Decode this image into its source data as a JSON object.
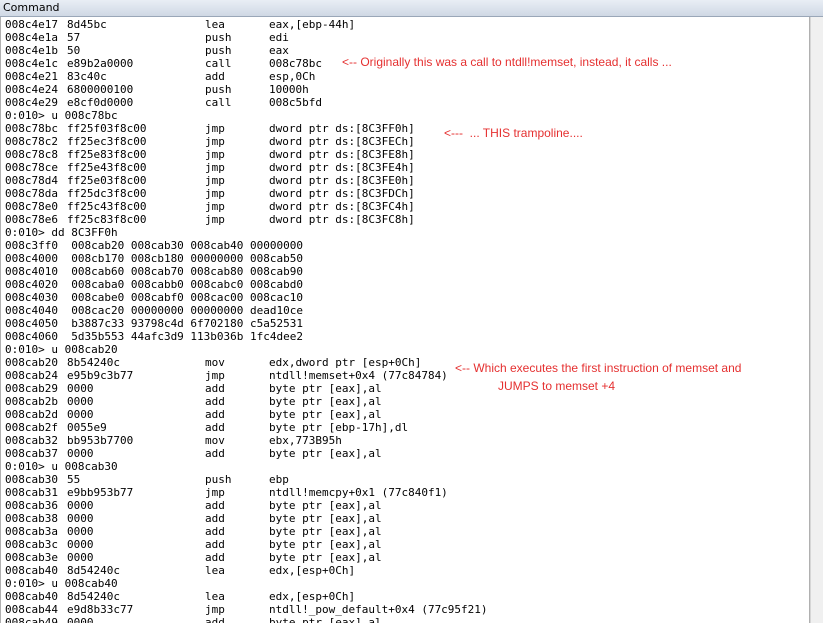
{
  "window": {
    "title": "Command"
  },
  "lines": [
    [
      "008c4e17",
      "8d45bc",
      "lea",
      "eax,[ebp-44h]"
    ],
    [
      "008c4e1a",
      "57",
      "push",
      "edi"
    ],
    [
      "008c4e1b",
      "50",
      "push",
      "eax"
    ],
    [
      "008c4e1c",
      "e89b2a0000",
      "call",
      "008c78bc"
    ],
    [
      "008c4e21",
      "83c40c",
      "add",
      "esp,0Ch"
    ],
    [
      "008c4e24",
      "6800000100",
      "push",
      "10000h"
    ],
    [
      "008c4e29",
      "e8cf0d0000",
      "call",
      "008c5bfd"
    ],
    [
      "0:010> u 008c78bc"
    ],
    [
      "008c78bc",
      "ff25f03f8c00",
      "jmp",
      "dword ptr ds:[8C3FF0h]"
    ],
    [
      "008c78c2",
      "ff25ec3f8c00",
      "jmp",
      "dword ptr ds:[8C3FECh]"
    ],
    [
      "008c78c8",
      "ff25e83f8c00",
      "jmp",
      "dword ptr ds:[8C3FE8h]"
    ],
    [
      "008c78ce",
      "ff25e43f8c00",
      "jmp",
      "dword ptr ds:[8C3FE4h]"
    ],
    [
      "008c78d4",
      "ff25e03f8c00",
      "jmp",
      "dword ptr ds:[8C3FE0h]"
    ],
    [
      "008c78da",
      "ff25dc3f8c00",
      "jmp",
      "dword ptr ds:[8C3FDCh]"
    ],
    [
      "008c78e0",
      "ff25c43f8c00",
      "jmp",
      "dword ptr ds:[8C3FC4h]"
    ],
    [
      "008c78e6",
      "ff25c83f8c00",
      "jmp",
      "dword ptr ds:[8C3FC8h]"
    ],
    [
      "0:010> dd 8C3FF0h"
    ],
    [
      "008c3ff0  008cab20 008cab30 008cab40 00000000"
    ],
    [
      "008c4000  008cb170 008cb180 00000000 008cab50"
    ],
    [
      "008c4010  008cab60 008cab70 008cab80 008cab90"
    ],
    [
      "008c4020  008cabа0 008cabb0 008cabc0 008cabd0"
    ],
    [
      "008c4030  008cabe0 008cabf0 008cac00 008cac10"
    ],
    [
      "008c4040  008cac20 00000000 00000000 dead10ce"
    ],
    [
      "008c4050  b3887c33 93798c4d 6f702180 c5a52531"
    ],
    [
      "008c4060  5d35b553 44afc3d9 113b036b 1fc4dee2"
    ],
    [
      "0:010> u 008cab20"
    ],
    [
      "008cab20",
      "8b54240c",
      "mov",
      "edx,dword ptr [esp+0Ch]"
    ],
    [
      "008cab24",
      "e95b9c3b77",
      "jmp",
      "ntdll!memset+0x4 (77c84784)"
    ],
    [
      "008cab29",
      "0000",
      "add",
      "byte ptr [eax],al"
    ],
    [
      "008cab2b",
      "0000",
      "add",
      "byte ptr [eax],al"
    ],
    [
      "008cab2d",
      "0000",
      "add",
      "byte ptr [eax],al"
    ],
    [
      "008cab2f",
      "0055e9",
      "add",
      "byte ptr [ebp-17h],dl"
    ],
    [
      "008cab32",
      "bb953b7700",
      "mov",
      "ebx,773B95h"
    ],
    [
      "008cab37",
      "0000",
      "add",
      "byte ptr [eax],al"
    ],
    [
      "0:010> u 008cab30"
    ],
    [
      "008cab30",
      "55",
      "push",
      "ebp"
    ],
    [
      "008cab31",
      "e9bb953b77",
      "jmp",
      "ntdll!memcpy+0x1 (77c840f1)"
    ],
    [
      "008cab36",
      "0000",
      "add",
      "byte ptr [eax],al"
    ],
    [
      "008cab38",
      "0000",
      "add",
      "byte ptr [eax],al"
    ],
    [
      "008cab3a",
      "0000",
      "add",
      "byte ptr [eax],al"
    ],
    [
      "008cab3c",
      "0000",
      "add",
      "byte ptr [eax],al"
    ],
    [
      "008cab3e",
      "0000",
      "add",
      "byte ptr [eax],al"
    ],
    [
      "008cab40",
      "8d54240c",
      "lea",
      "edx,[esp+0Ch]"
    ],
    [
      "0:010> u 008cab40"
    ],
    [
      "008cab40",
      "8d54240c",
      "lea",
      "edx,[esp+0Ch]"
    ],
    [
      "008cab44",
      "e9d8b33c77",
      "jmp",
      "ntdll!_pow_default+0x4 (77c95f21)"
    ],
    [
      "008cab49",
      "0000",
      "add",
      "byte ptr [eax],al"
    ]
  ],
  "annotations": {
    "call_note": "<-- Originally this was a call to ntdll!memset, instead, it calls ...",
    "trampoline_note": "<---  ... THIS trampoline....",
    "memset_note_line1": "<-- Which executes the first instruction of memset and",
    "memset_note_line2": "JUMPS to memset +4"
  }
}
